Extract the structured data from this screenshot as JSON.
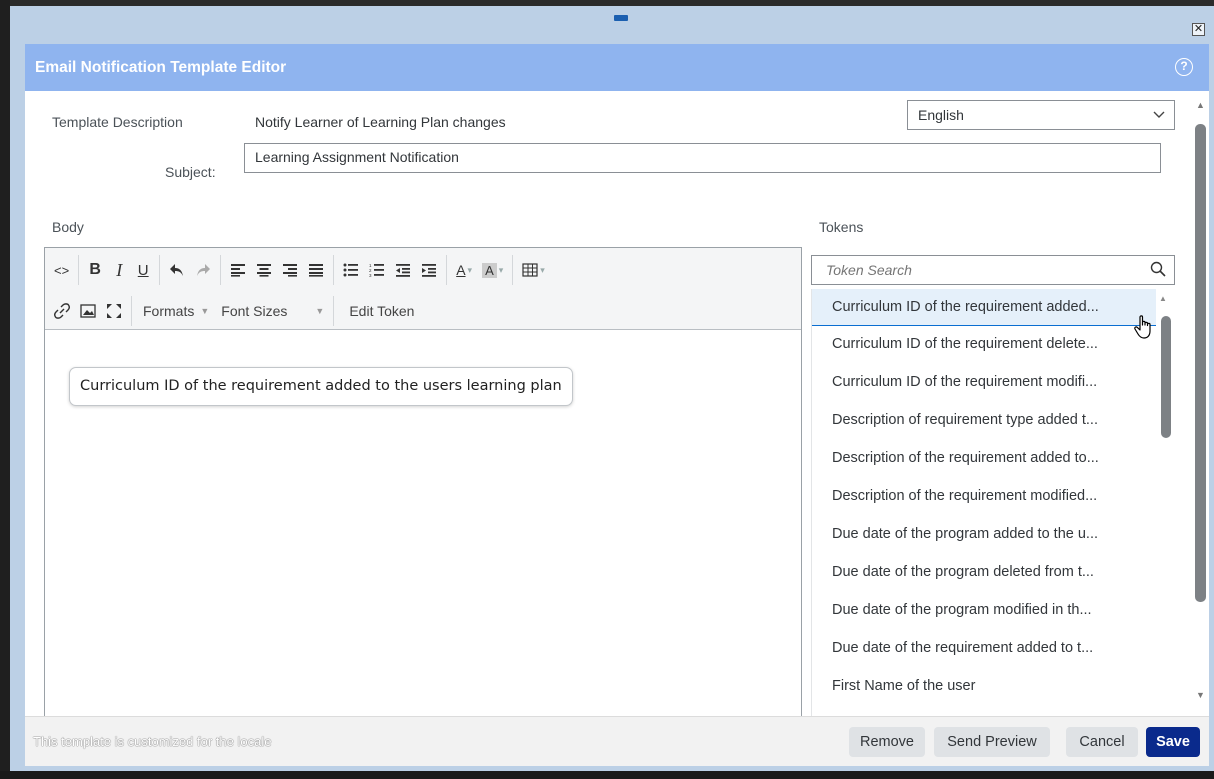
{
  "dialog": {
    "title": "Email Notification Template Editor",
    "close_glyph": "✕",
    "help_glyph": "?"
  },
  "form": {
    "description_label": "Template Description",
    "description_value": "Notify Learner of Learning Plan changes",
    "language_value": "English",
    "subject_label": "Subject:",
    "subject_value": "Learning Assignment Notification",
    "body_label": "Body",
    "tokens_label": "Tokens"
  },
  "toolbar": {
    "formats_label": "Formats",
    "font_sizes_label": "Font Sizes",
    "edit_token_label": "Edit Token",
    "code_glyph": "<>",
    "bold_glyph": "B",
    "italic_glyph": "I",
    "underline_glyph": "U",
    "text_color_glyph": "A",
    "bg_color_glyph": "A"
  },
  "editor": {
    "token_chip_text": "Curriculum ID of the requirement added to the users learning plan"
  },
  "tokens": {
    "search_placeholder": "Token Search",
    "items": [
      "Curriculum ID of the requirement added...",
      "Curriculum ID of the requirement delete...",
      "Curriculum ID of the requirement modifi...",
      "Description of requirement type added t...",
      "Description of the requirement added to...",
      "Description of the requirement modified...",
      "Due date of the program added to the u...",
      "Due date of the program deleted from t...",
      "Due date of the program modified in th...",
      "Due date of the requirement added to t...",
      "First Name of the user"
    ],
    "selected_index": 0
  },
  "footer": {
    "note": "This template is customized for the locale",
    "remove_label": "Remove",
    "send_preview_label": "Send Preview",
    "cancel_label": "Cancel",
    "save_label": "Save"
  },
  "colors": {
    "title_bar": "#8fb4ef",
    "primary_button": "#0a2a8c",
    "selection_border": "#0a6ed1"
  },
  "icons": [
    "drag-handle-icon",
    "close-icon",
    "help-icon",
    "chevron-down-icon",
    "search-icon",
    "undo-icon",
    "redo-icon",
    "link-icon",
    "image-icon",
    "fullscreen-icon",
    "table-icon",
    "hand-cursor-icon"
  ]
}
